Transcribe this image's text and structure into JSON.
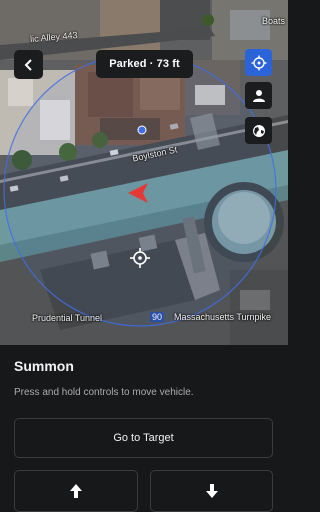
{
  "map": {
    "street_labels": {
      "alley": "lic Alley 443",
      "boylston": "Boylston St",
      "prudential": "Prudential Tunnel",
      "massachusetts": "Massachusetts Turnpike",
      "route_shield": "90",
      "boats": "Boats"
    },
    "colors": {
      "summon_radius": "#3f6fe8",
      "car_arrow": "#e53935",
      "recenter_button": "#2a64d8"
    }
  },
  "header": {
    "back_icon": "chevron-left-icon",
    "status": "Parked · 73 ft"
  },
  "side_buttons": [
    {
      "icon": "target-icon"
    },
    {
      "icon": "person-icon"
    },
    {
      "icon": "globe-icon"
    }
  ],
  "panel": {
    "title": "Summon",
    "subtitle": "Press and hold controls to move vehicle.",
    "go_to_target": "Go to Target",
    "forward_icon": "arrow-up-icon",
    "reverse_icon": "arrow-down-icon"
  }
}
